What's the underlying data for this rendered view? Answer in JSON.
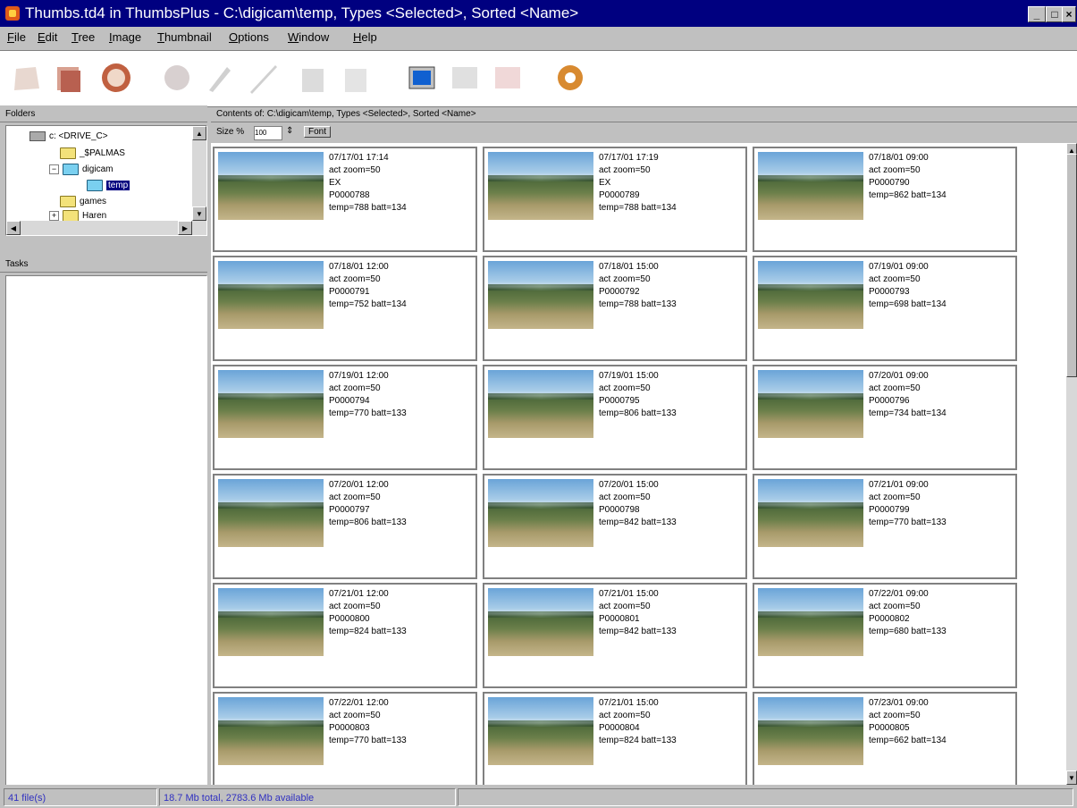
{
  "window": {
    "title": "Thumbs.td4 in ThumbsPlus - C:\\digicam\\temp, Types <Selected>, Sorted <Name>",
    "btn_min": "_",
    "btn_max": "□",
    "btn_close": "×"
  },
  "menu": [
    "File",
    "Edit",
    "Tree",
    "Image",
    "Thumbnail",
    "Options",
    "Window",
    "Help"
  ],
  "folders_pane": {
    "header": "Folders",
    "tree": [
      "c: <DRIVE_C>",
      "_$PALMAS",
      "digicam",
      "temp",
      "games",
      "Haren"
    ]
  },
  "tasks_pane": {
    "header": "Tasks"
  },
  "contents": {
    "header": "Contents of: C:\\digicam\\temp, Types <Selected>, Sorted <Name>",
    "size_label": "Size %",
    "size_value": "100",
    "font_button": "Font"
  },
  "thumbnails": [
    {
      "date": "07/17/01  17:14",
      "zoom": "act zoom=50",
      "extra": "EX",
      "file": "P0000788",
      "temp": "temp=788 batt=134"
    },
    {
      "date": "07/17/01  17:19",
      "zoom": "act zoom=50",
      "extra": "EX",
      "file": "P0000789",
      "temp": "temp=788 batt=134"
    },
    {
      "date": "07/18/01  09:00",
      "zoom": "act zoom=50",
      "extra": "",
      "file": "P0000790",
      "temp": "temp=862 batt=134"
    },
    {
      "date": "07/18/01  12:00",
      "zoom": "act zoom=50",
      "extra": "",
      "file": "P0000791",
      "temp": "temp=752 batt=134"
    },
    {
      "date": "07/18/01  15:00",
      "zoom": "act zoom=50",
      "extra": "",
      "file": "P0000792",
      "temp": "temp=788 batt=133"
    },
    {
      "date": "07/19/01  09:00",
      "zoom": "act zoom=50",
      "extra": "",
      "file": "P0000793",
      "temp": "temp=698 batt=134"
    },
    {
      "date": "07/19/01  12:00",
      "zoom": "act zoom=50",
      "extra": "",
      "file": "P0000794",
      "temp": "temp=770 batt=133"
    },
    {
      "date": "07/19/01  15:00",
      "zoom": "act zoom=50",
      "extra": "",
      "file": "P0000795",
      "temp": "temp=806 batt=133"
    },
    {
      "date": "07/20/01  09:00",
      "zoom": "act zoom=50",
      "extra": "",
      "file": "P0000796",
      "temp": "temp=734 batt=134"
    },
    {
      "date": "07/20/01  12:00",
      "zoom": "act zoom=50",
      "extra": "",
      "file": "P0000797",
      "temp": "temp=806 batt=133"
    },
    {
      "date": "07/20/01  15:00",
      "zoom": "act zoom=50",
      "extra": "",
      "file": "P0000798",
      "temp": "temp=842 batt=133"
    },
    {
      "date": "07/21/01  09:00",
      "zoom": "act zoom=50",
      "extra": "",
      "file": "P0000799",
      "temp": "temp=770 batt=133"
    },
    {
      "date": "07/21/01  12:00",
      "zoom": "act zoom=50",
      "extra": "",
      "file": "P0000800",
      "temp": "temp=824 batt=133"
    },
    {
      "date": "07/21/01  15:00",
      "zoom": "act zoom=50",
      "extra": "",
      "file": "P0000801",
      "temp": "temp=842 batt=133"
    },
    {
      "date": "07/22/01  09:00",
      "zoom": "act zoom=50",
      "extra": "",
      "file": "P0000802",
      "temp": "temp=680 batt=133"
    },
    {
      "date": "07/22/01  12:00",
      "zoom": "act zoom=50",
      "extra": "",
      "file": "P0000803",
      "temp": "temp=770 batt=133"
    },
    {
      "date": "07/21/01  15:00",
      "zoom": "act zoom=50",
      "extra": "",
      "file": "P0000804",
      "temp": "temp=824 batt=133"
    },
    {
      "date": "07/23/01  09:00",
      "zoom": "act zoom=50",
      "extra": "",
      "file": "P0000805",
      "temp": "temp=662 batt=134"
    }
  ],
  "status": {
    "files": "41 file(s)",
    "size": "18.7 Mb total, 2783.6 Mb available"
  }
}
